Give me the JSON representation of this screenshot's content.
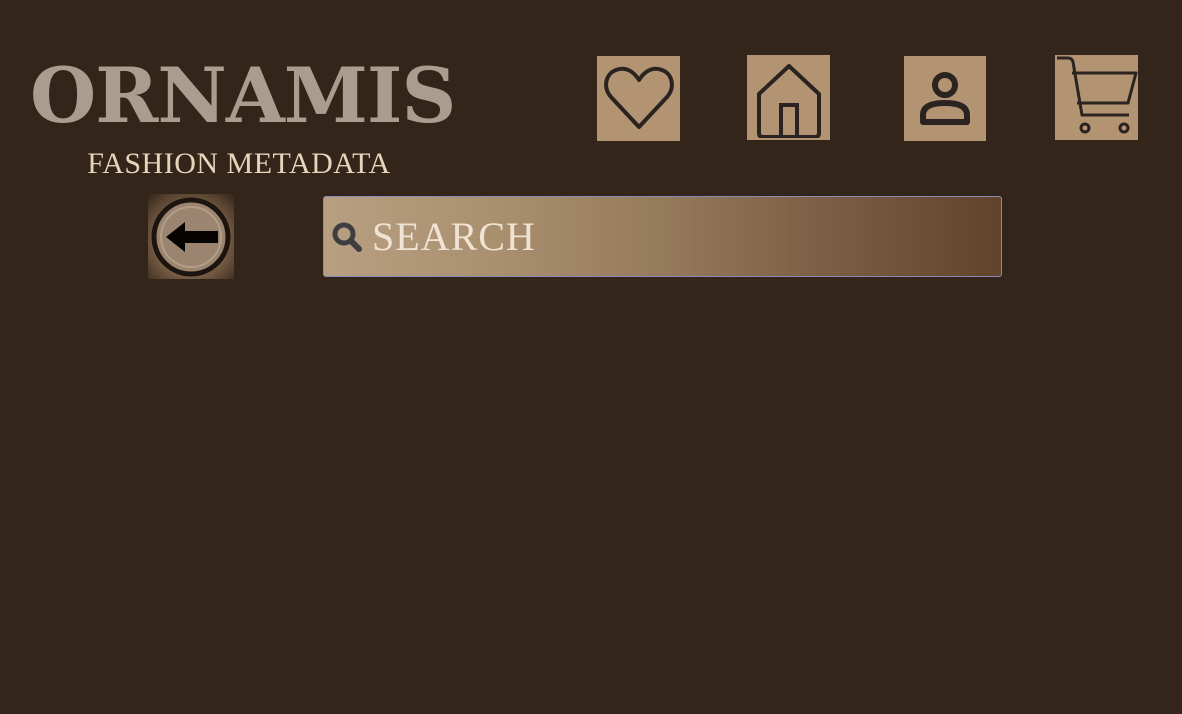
{
  "brand": {
    "name": "ORNAMIS",
    "tagline": "FASHION METADATA"
  },
  "nav": {
    "items": [
      {
        "icon": "heart-icon"
      },
      {
        "icon": "home-icon"
      },
      {
        "icon": "user-icon"
      },
      {
        "icon": "cart-icon"
      }
    ]
  },
  "back": {
    "icon": "arrow-left-icon"
  },
  "search": {
    "placeholder": "SEARCH",
    "value": "",
    "icon": "search-icon"
  },
  "colors": {
    "background": "#33251a",
    "button": "#b39472",
    "brand_text": "#ab9d8e",
    "tagline_text": "#e7d5bb",
    "icon_stroke": "#2b2320"
  }
}
